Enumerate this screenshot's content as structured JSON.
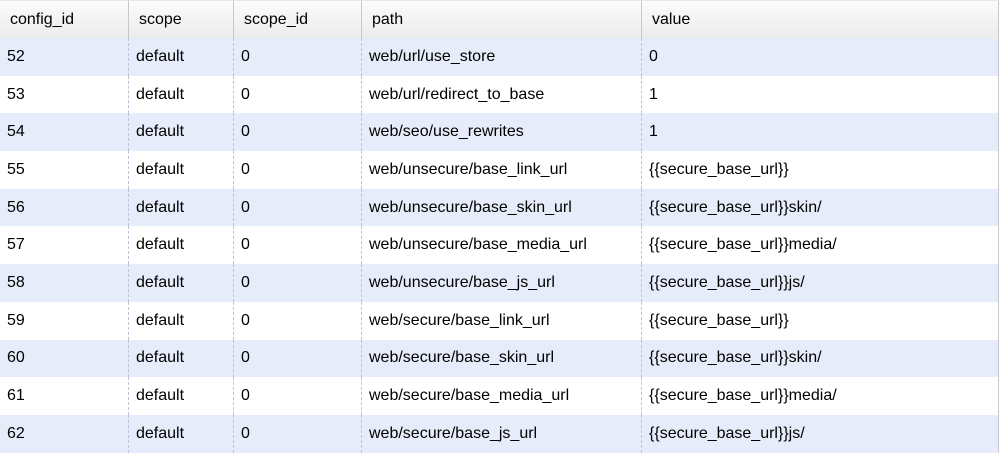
{
  "table": {
    "columns": [
      "config_id",
      "scope",
      "scope_id",
      "path",
      "value"
    ],
    "rows": [
      [
        "52",
        "default",
        "0",
        "web/url/use_store",
        "0"
      ],
      [
        "53",
        "default",
        "0",
        "web/url/redirect_to_base",
        "1"
      ],
      [
        "54",
        "default",
        "0",
        "web/seo/use_rewrites",
        "1"
      ],
      [
        "55",
        "default",
        "0",
        "web/unsecure/base_link_url",
        "{{secure_base_url}}"
      ],
      [
        "56",
        "default",
        "0",
        "web/unsecure/base_skin_url",
        "{{secure_base_url}}skin/"
      ],
      [
        "57",
        "default",
        "0",
        "web/unsecure/base_media_url",
        "{{secure_base_url}}media/"
      ],
      [
        "58",
        "default",
        "0",
        "web/unsecure/base_js_url",
        "{{secure_base_url}}js/"
      ],
      [
        "59",
        "default",
        "0",
        "web/secure/base_link_url",
        "{{secure_base_url}}"
      ],
      [
        "60",
        "default",
        "0",
        "web/secure/base_skin_url",
        "{{secure_base_url}}skin/"
      ],
      [
        "61",
        "default",
        "0",
        "web/secure/base_media_url",
        "{{secure_base_url}}media/"
      ],
      [
        "62",
        "default",
        "0",
        "web/secure/base_js_url",
        "{{secure_base_url}}js/"
      ]
    ]
  },
  "colors": {
    "alt_row": "#e6ecf9",
    "header_bg": "#f1f1f1",
    "grid_line": "#bcc3d6"
  }
}
